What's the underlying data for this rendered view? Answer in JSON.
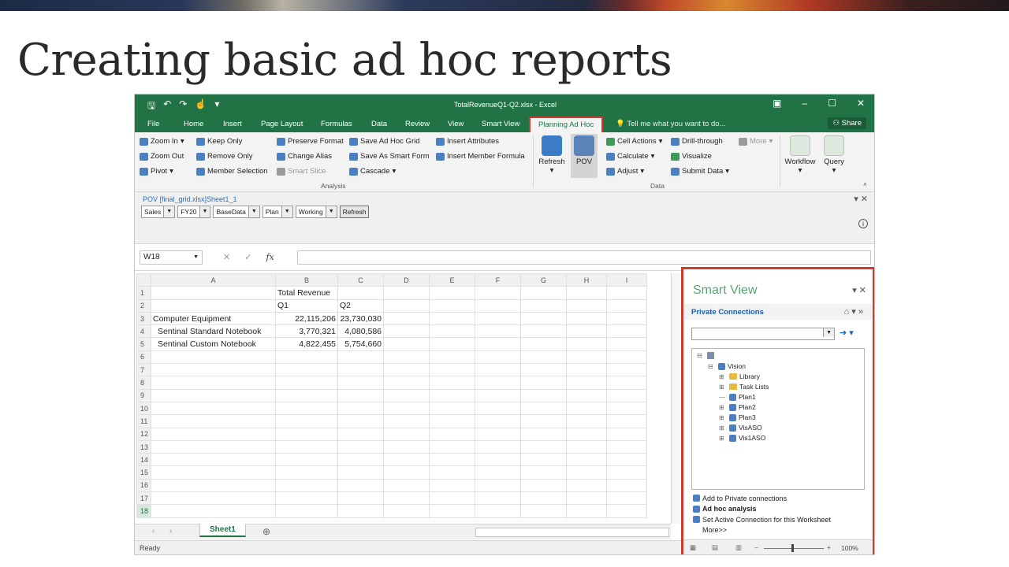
{
  "slide": {
    "title": "Creating basic ad hoc reports"
  },
  "window": {
    "title": "TotalRevenueQ1-Q2.xlsx - Excel"
  },
  "tabs": [
    "File",
    "Home",
    "Insert",
    "Page Layout",
    "Formulas",
    "Data",
    "Review",
    "View",
    "Smart View",
    "Planning Ad Hoc"
  ],
  "active_tab": "Planning Ad Hoc",
  "tell_me": "Tell me what you want to do...",
  "share": "Share",
  "ribbon": {
    "analysis": {
      "zoom_in": "Zoom In",
      "zoom_out": "Zoom Out",
      "pivot": "Pivot",
      "keep_only": "Keep Only",
      "remove_only": "Remove Only",
      "member_selection": "Member Selection",
      "preserve_format": "Preserve Format",
      "change_alias": "Change Alias",
      "smart_slice": "Smart Slice",
      "save_ad_hoc_grid": "Save Ad Hoc Grid",
      "save_as_smart_form": "Save As Smart Form",
      "cascade": "Cascade",
      "insert_attributes": "Insert Attributes",
      "insert_member_formula": "Insert Member Formula",
      "group_label": "Analysis"
    },
    "data": {
      "refresh": "Refresh",
      "pov": "POV",
      "cell_actions": "Cell Actions",
      "calculate": "Calculate",
      "adjust": "Adjust",
      "drill_through": "Drill-through",
      "visualize": "Visualize",
      "submit_data": "Submit Data",
      "more": "More",
      "group_label": "Data"
    },
    "workflow": "Workflow",
    "query": "Query"
  },
  "pov": {
    "title": "POV [final_grid.xlsx]Sheet1_1",
    "members": [
      "Sales",
      "FY20",
      "BaseData",
      "Plan",
      "Working"
    ],
    "refresh": "Refresh"
  },
  "name_box": "W18",
  "fx": "fx",
  "grid": {
    "columns": [
      "A",
      "B",
      "C",
      "D",
      "E",
      "F",
      "G",
      "H",
      "I"
    ],
    "rows": [
      [
        "1",
        "",
        "Total Revenue",
        ""
      ],
      [
        "2",
        "",
        "Q1",
        "Q2"
      ],
      [
        "3",
        "Computer Equipment",
        "22,115,206",
        "23,730,030"
      ],
      [
        "4",
        "  Sentinal Standard Notebook",
        "3,770,321",
        "4,080,586"
      ],
      [
        "5",
        "  Sentinal Custom Notebook",
        "4,822,455",
        "5,754,660"
      ],
      [
        "6",
        "",
        "",
        ""
      ],
      [
        "7",
        "",
        "",
        ""
      ],
      [
        "8",
        "",
        "",
        ""
      ],
      [
        "9",
        "",
        "",
        ""
      ],
      [
        "10",
        "",
        "",
        ""
      ],
      [
        "11",
        "",
        "",
        ""
      ],
      [
        "12",
        "",
        "",
        ""
      ],
      [
        "13",
        "",
        "",
        ""
      ],
      [
        "14",
        "",
        "",
        ""
      ],
      [
        "15",
        "",
        "",
        ""
      ],
      [
        "16",
        "",
        "",
        ""
      ],
      [
        "17",
        "",
        "",
        ""
      ],
      [
        "18",
        "",
        "",
        ""
      ]
    ],
    "selected_row": "18"
  },
  "sheet_tab": "Sheet1",
  "status": "Ready",
  "smart_view": {
    "title": "Smart View",
    "connections_label": "Private Connections",
    "tree": {
      "root": "Vision",
      "children": [
        "Library",
        "Task Lists",
        "Plan1",
        "Plan2",
        "Plan3",
        "VisASO",
        "Vis1ASO"
      ]
    },
    "actions": [
      "Add to Private connections",
      "Ad hoc analysis",
      "Set Active Connection for this Worksheet",
      "More>>"
    ],
    "zoom": "100%"
  }
}
